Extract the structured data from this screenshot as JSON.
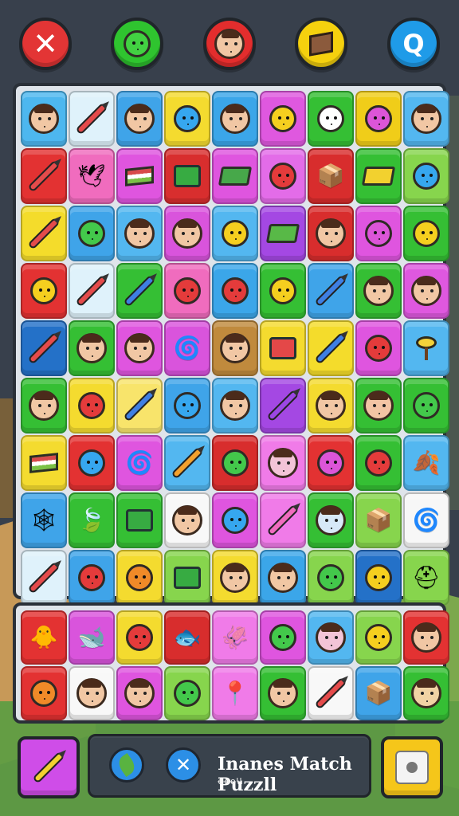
{
  "header": {
    "buttons": [
      {
        "name": "close-button",
        "label": "✕",
        "color": "#e33535"
      },
      {
        "name": "creature-button",
        "label": "",
        "color": "#2fc42f"
      },
      {
        "name": "person-button",
        "label": "",
        "color": "#e32d2d"
      },
      {
        "name": "box-button",
        "label": "",
        "color": "#f5d10e"
      },
      {
        "name": "search-button",
        "label": "Q",
        "color": "#1f9be8"
      }
    ]
  },
  "board": {
    "rows": [
      [
        {
          "bg": "#4db7ef",
          "kind": "person"
        },
        {
          "bg": "#dff2fb",
          "kind": "pencil"
        },
        {
          "bg": "#3fa4e9",
          "kind": "person"
        },
        {
          "bg": "#f4db2f",
          "kind": "blob-blue"
        },
        {
          "bg": "#3ba6e9",
          "kind": "person"
        },
        {
          "bg": "#df58df",
          "kind": "blob-yellow"
        },
        {
          "bg": "#35bf34",
          "kind": "blob-white"
        },
        {
          "bg": "#f0cd19",
          "kind": "blob-pink"
        },
        {
          "bg": "#53b7f0",
          "kind": "person"
        }
      ],
      [
        {
          "bg": "#e33232",
          "kind": "pencil"
        },
        {
          "bg": "#f06cbe",
          "kind": "bird"
        },
        {
          "bg": "#df55df",
          "kind": "flag"
        },
        {
          "bg": "#d82e2e",
          "kind": "house-green"
        },
        {
          "bg": "#df55df",
          "kind": "book"
        },
        {
          "bg": "#e36ce8",
          "kind": "blob-red"
        },
        {
          "bg": "#d82d2d",
          "kind": "box"
        },
        {
          "bg": "#35bf34",
          "kind": "book-yellow"
        },
        {
          "bg": "#87d54d",
          "kind": "blob-blue"
        }
      ],
      [
        {
          "bg": "#f4dc2b",
          "kind": "pencil"
        },
        {
          "bg": "#3fa4e9",
          "kind": "blob-green"
        },
        {
          "bg": "#53b7f0",
          "kind": "person"
        },
        {
          "bg": "#d954dc",
          "kind": "person-purple"
        },
        {
          "bg": "#53b7f0",
          "kind": "blob-yellow"
        },
        {
          "bg": "#a448e3",
          "kind": "book-green"
        },
        {
          "bg": "#d82d2d",
          "kind": "person-purple"
        },
        {
          "bg": "#df55df",
          "kind": "blob-pink"
        },
        {
          "bg": "#35bf34",
          "kind": "blob-yellow"
        }
      ],
      [
        {
          "bg": "#e33232",
          "kind": "blob-yellow"
        },
        {
          "bg": "#dff2fb",
          "kind": "pencil"
        },
        {
          "bg": "#35bf34",
          "kind": "pencil-blue"
        },
        {
          "bg": "#f06cbe",
          "kind": "blob-red"
        },
        {
          "bg": "#3ba6e9",
          "kind": "blob-red"
        },
        {
          "bg": "#35bf34",
          "kind": "blob-yellow"
        },
        {
          "bg": "#3fa4e9",
          "kind": "pencil-blue"
        },
        {
          "bg": "#35bf34",
          "kind": "person-helmet"
        },
        {
          "bg": "#df58df",
          "kind": "person-purple"
        }
      ],
      [
        {
          "bg": "#2471c8",
          "kind": "pencil"
        },
        {
          "bg": "#35bf34",
          "kind": "person"
        },
        {
          "bg": "#df55df",
          "kind": "person-purple"
        },
        {
          "bg": "#d954dc",
          "kind": "swirl"
        },
        {
          "bg": "#c08a3d",
          "kind": "person-purple"
        },
        {
          "bg": "#f4db2f",
          "kind": "house-red"
        },
        {
          "bg": "#f4dc2b",
          "kind": "pencil-blue"
        },
        {
          "bg": "#df55df",
          "kind": "blob-red"
        },
        {
          "bg": "#53b7f0",
          "kind": "tree"
        }
      ],
      [
        {
          "bg": "#35bf34",
          "kind": "person"
        },
        {
          "bg": "#f4db2f",
          "kind": "blob-red"
        },
        {
          "bg": "#f8e46b",
          "kind": "pencil-blue"
        },
        {
          "bg": "#3fa4e9",
          "kind": "blob-blue"
        },
        {
          "bg": "#53b7f0",
          "kind": "person-helmet"
        },
        {
          "bg": "#a448e3",
          "kind": "pencil-purple"
        },
        {
          "bg": "#f4db2f",
          "kind": "person"
        },
        {
          "bg": "#35bf34",
          "kind": "person-orange"
        },
        {
          "bg": "#35bf34",
          "kind": "blob-green"
        }
      ],
      [
        {
          "bg": "#f4db2f",
          "kind": "flag"
        },
        {
          "bg": "#e33232",
          "kind": "blob-blue"
        },
        {
          "bg": "#df55df",
          "kind": "swirl-blue"
        },
        {
          "bg": "#53b7f0",
          "kind": "pencil-orange"
        },
        {
          "bg": "#d82d2d",
          "kind": "blob-green"
        },
        {
          "bg": "#f07be8",
          "kind": "person-pink"
        },
        {
          "bg": "#e33232",
          "kind": "blob-pink"
        },
        {
          "bg": "#35bf34",
          "kind": "blob-red"
        },
        {
          "bg": "#53b7f0",
          "kind": "leaf"
        }
      ],
      [
        {
          "bg": "#3fa4e9",
          "kind": "web"
        },
        {
          "bg": "#35bf34",
          "kind": "leaf-green"
        },
        {
          "bg": "#35bf34",
          "kind": "house-green"
        },
        {
          "bg": "#f8f8f8",
          "kind": "person"
        },
        {
          "bg": "#df55df",
          "kind": "blob-blue"
        },
        {
          "bg": "#f07be8",
          "kind": "pencil-pink"
        },
        {
          "bg": "#35bf34",
          "kind": "person-blue"
        },
        {
          "bg": "#87d54d",
          "kind": "box"
        },
        {
          "bg": "#f7f7f7",
          "kind": "swirl-red"
        }
      ],
      [
        {
          "bg": "#dff2fb",
          "kind": "pencil"
        },
        {
          "bg": "#3fa4e9",
          "kind": "blob-red"
        },
        {
          "bg": "#f4db2f",
          "kind": "blob-orange"
        },
        {
          "bg": "#87d54d",
          "kind": "house-green"
        },
        {
          "bg": "#f4db2f",
          "kind": "person-purple"
        },
        {
          "bg": "#3ba6e9",
          "kind": "person"
        },
        {
          "bg": "#87d54d",
          "kind": "blob-green"
        },
        {
          "bg": "#2471c8",
          "kind": "blob-yellow"
        },
        {
          "bg": "#87d54d",
          "kind": "helmet"
        }
      ]
    ]
  },
  "tray": {
    "rows": [
      [
        {
          "bg": "#e33232",
          "kind": "bird-yellow"
        },
        {
          "bg": "#d954dc",
          "kind": "whale"
        },
        {
          "bg": "#f4db2f",
          "kind": "blob-red"
        },
        {
          "bg": "#d82d2d",
          "kind": "fish-blue"
        },
        {
          "bg": "#f07be8",
          "kind": "squid"
        },
        {
          "bg": "#df55df",
          "kind": "blob-green"
        },
        {
          "bg": "#53b7f0",
          "kind": "person-pink"
        },
        {
          "bg": "#87d54d",
          "kind": "blob-yellow"
        },
        {
          "bg": "#e33232",
          "kind": "person-purple"
        }
      ],
      [
        {
          "bg": "#e33232",
          "kind": "blob-orange"
        },
        {
          "bg": "#f8f8f8",
          "kind": "person-purple"
        },
        {
          "bg": "#df55df",
          "kind": "person-purple"
        },
        {
          "bg": "#87d54d",
          "kind": "blob-green"
        },
        {
          "bg": "#f07be8",
          "kind": "pin"
        },
        {
          "bg": "#35bf34",
          "kind": "person"
        },
        {
          "bg": "#f8f8f8",
          "kind": "pencil"
        },
        {
          "bg": "#3fa4e9",
          "kind": "box-yellow"
        },
        {
          "bg": "#35bf34",
          "kind": "person-yellow"
        }
      ]
    ]
  },
  "footer": {
    "title": "Inanes Match Puzzll",
    "subtitle": "ꝋꝋꝋꝇꝇ",
    "left_button_label": "",
    "right_button_label": "",
    "orb_x_label": "✕"
  }
}
